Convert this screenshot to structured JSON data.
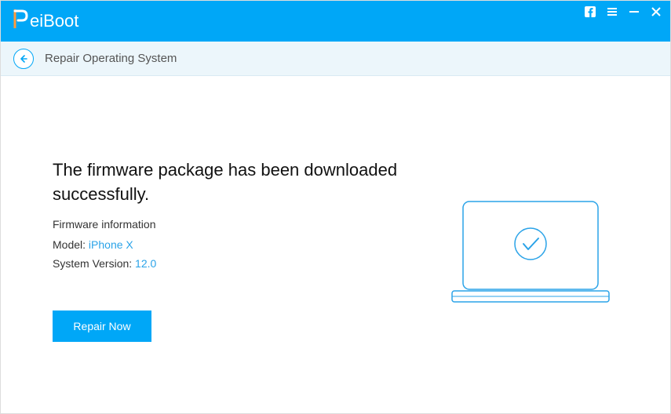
{
  "app": {
    "name": "ReiBoot"
  },
  "breadcrumb": {
    "title": "Repair Operating System"
  },
  "main": {
    "heading": "The firmware package has been downloaded successfully.",
    "subheading": "Firmware information",
    "model_label": "Model:",
    "model_value": "iPhone X",
    "version_label": "System Version:",
    "version_value": "12.0",
    "repair_button": "Repair Now"
  }
}
